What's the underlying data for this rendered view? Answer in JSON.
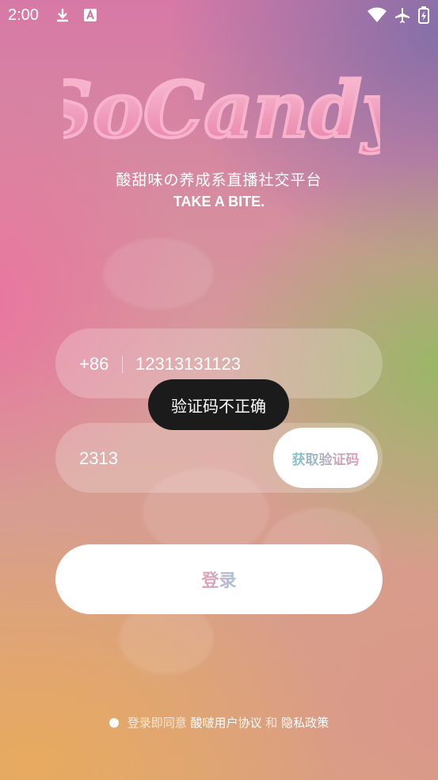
{
  "status_bar": {
    "time": "2:00"
  },
  "app": {
    "logo_text": "SoCandy",
    "tagline": "酸甜味の养成系直播社交平台",
    "slogan": "TAKE A BITE."
  },
  "phone_field": {
    "country_code": "+86",
    "value": "12313131123"
  },
  "code_field": {
    "value": "2313",
    "get_code_label": "获取验证码"
  },
  "toast": {
    "message": "验证码不正确"
  },
  "login_button": {
    "label": "登录"
  },
  "agreement": {
    "prefix": "登录即同意",
    "user_agreement": "酸啵用户协议",
    "and": "和",
    "privacy_policy": "隐私政策"
  },
  "colors": {
    "accent_pink": "#e39ab6",
    "accent_teal": "#8bc1c3",
    "toast_bg": "#1b1b1b"
  }
}
